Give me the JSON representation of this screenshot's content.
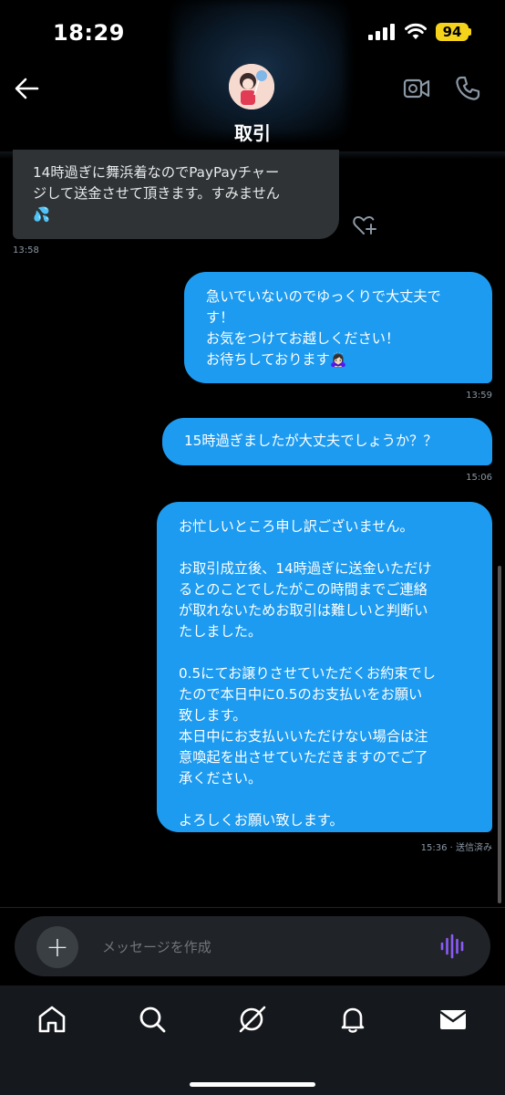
{
  "status_bar": {
    "time": "18:29",
    "battery": "94"
  },
  "header": {
    "title": "取引"
  },
  "messages": [
    {
      "direction": "in",
      "text": "14時過ぎに舞浜着なのでPayPayチャー\nジして送金させて頂きます。すみません\n💦",
      "timestamp": "13:58"
    },
    {
      "direction": "out",
      "text": "急いでいないのでゆっくりで大丈夫で\nす！\nお気をつけてお越しください！\nお待ちしております🙇🏻‍♀️",
      "timestamp": "13:59"
    },
    {
      "direction": "out",
      "text": "15時過ぎましたが大丈夫でしょうか？？",
      "timestamp": "15:06"
    },
    {
      "direction": "out",
      "text": "お忙しいところ申し訳ございません。\n\nお取引成立後、14時過ぎに送金いただけ\nるとのことでしたがこの時間までご連絡\nが取れないためお取引は難しいと判断い\nたしました。\n\n0.5にてお譲りさせていただくお約束でし\nたので本日中に0.5のお支払いをお願い\n致します。\n本日中にお支払いいただけない場合は注\n意喚起を出させていただきますのでご了\n承ください。\n\nよろしくお願い致します。",
      "timestamp": "15:36 · 送信済み"
    }
  ],
  "composer": {
    "placeholder": "メッセージを作成"
  },
  "colors": {
    "accent": "#1d9bf0",
    "incoming": "#2f3336",
    "voice": "#8a5cf5",
    "battery": "#f6d31b"
  },
  "icons": [
    "back-arrow-icon",
    "video-call-icon",
    "phone-icon",
    "heart-plus-icon",
    "plus-icon",
    "voice-icon",
    "home-icon",
    "search-icon",
    "grok-icon",
    "bell-icon",
    "mail-icon"
  ]
}
